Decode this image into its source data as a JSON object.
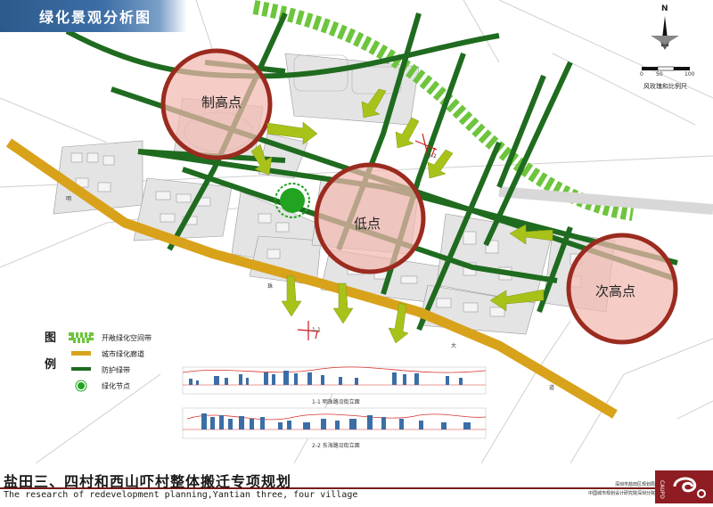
{
  "title": "绿化景观分析图",
  "footer": {
    "title_cn": "盐田三、四村和西山吓村整体搬迁专项规划",
    "title_en": "The research of redevelopment planning,Yantian three, four village",
    "org_line1": "深圳市盐田区规划局",
    "org_line2": "中国城市规划设计研究院深圳分院"
  },
  "logo_text": "CAUPD",
  "north_label": "N",
  "scale_caption": "风玫瑰和比例尺",
  "scale_ticks": [
    "0",
    "50",
    "100"
  ],
  "legend": {
    "title_chars": [
      "图",
      "例"
    ],
    "items": [
      {
        "label": "开敞绿化空间带",
        "icon": "dashed-green-band-icon",
        "color": "#6dc53d"
      },
      {
        "label": "城市绿化廊道",
        "icon": "orange-corridor-icon",
        "color": "#d9a21b"
      },
      {
        "label": "防护绿带",
        "icon": "dark-green-belt-icon",
        "color": "#1f6b1f"
      },
      {
        "label": "绿化节点",
        "icon": "green-node-icon",
        "color": "#22a422"
      }
    ]
  },
  "points": [
    {
      "label": "制高点"
    },
    {
      "label": "低点"
    },
    {
      "label": "次高点"
    }
  ],
  "section_marks": [
    "2-2",
    "1-1"
  ],
  "road_chars": [
    "明",
    "珠",
    "大",
    "道"
  ],
  "elevations": [
    {
      "caption": "1-1 明珠路沿街立面"
    },
    {
      "caption": "2-2 东海路沿街立面"
    }
  ],
  "colors": {
    "accent": "#2b5a8c",
    "corridor": "#d9a21b",
    "belt": "#1f6b1f",
    "open_band": "#6dc53d",
    "point_fill": "#f2b9b0",
    "point_ring": "#9b2b1f",
    "arrow": "#a9c21a",
    "node": "#22a422"
  }
}
